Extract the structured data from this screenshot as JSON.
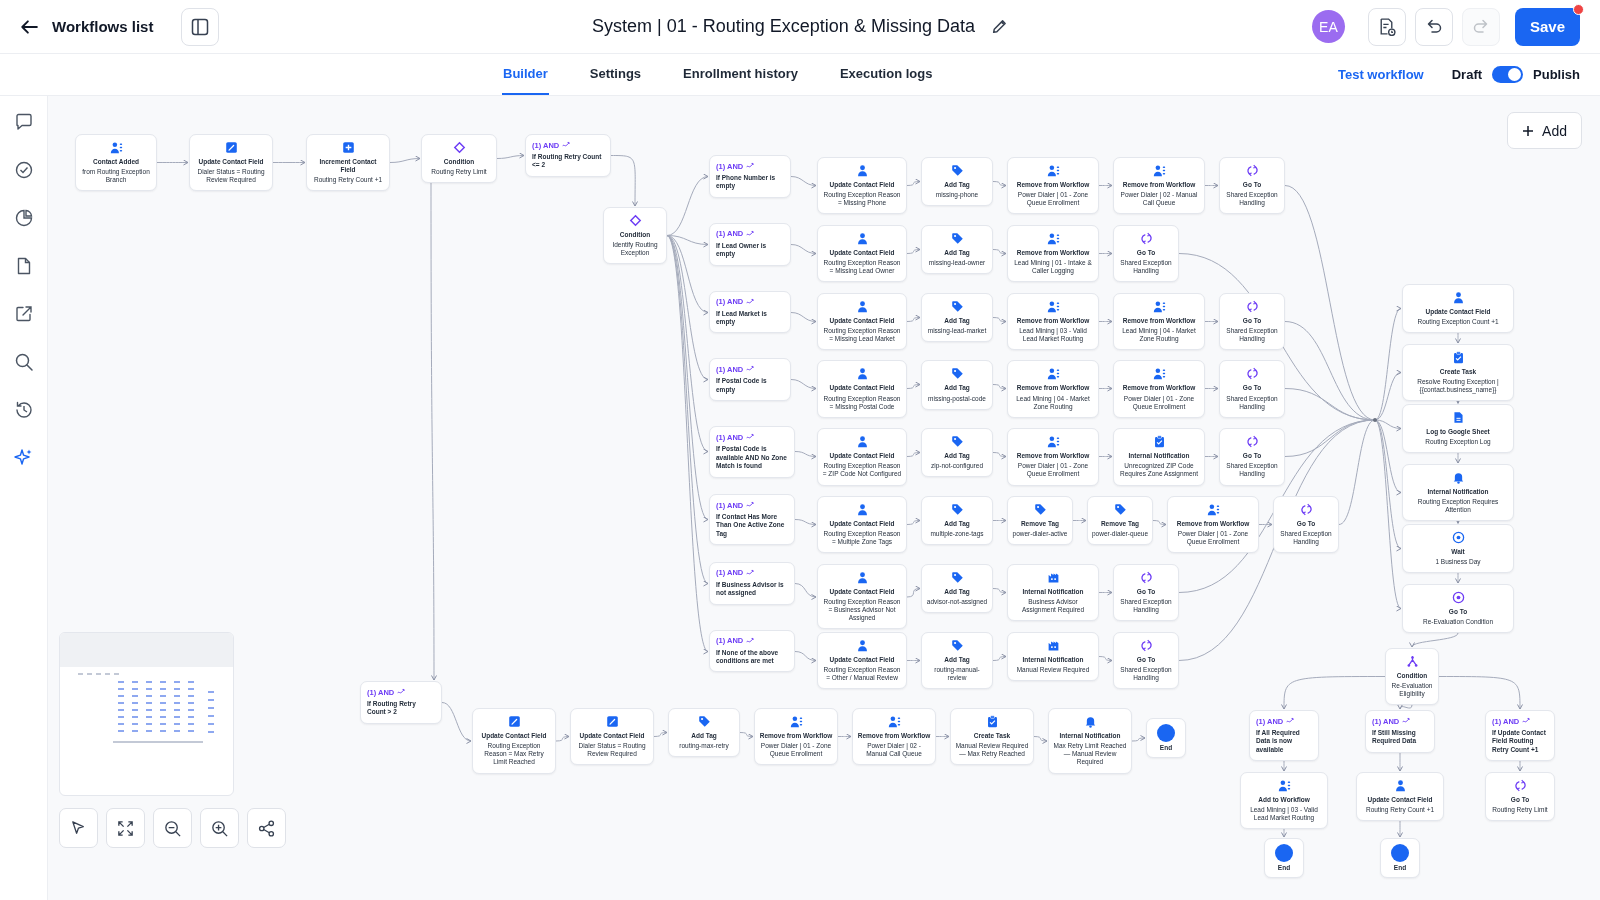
{
  "header": {
    "back_link": "Workflows list",
    "title": "System | 01 - Routing Exception & Missing Data",
    "avatar": "EA",
    "history": [
      {
        "kind": "undo",
        "disabled": false
      },
      {
        "kind": "redo",
        "disabled": true
      }
    ],
    "save": "Save",
    "unsaved": true
  },
  "tabs": [
    {
      "label": "Builder",
      "selected": true
    },
    {
      "label": "Settings",
      "selected": false
    },
    {
      "label": "Enrollment history",
      "selected": false
    },
    {
      "label": "Execution logs",
      "selected": false
    }
  ],
  "test_workflow": "Test workflow",
  "draft_label": "Draft",
  "publish_toggle": {
    "on": true
  },
  "publish_label": "Publish",
  "canvas": {
    "add_button": "Add",
    "start_chain": [
      {
        "kind": "trigger",
        "title": "Contact Added",
        "detail": "from Routing Exception Branch"
      },
      {
        "kind": "field_edit",
        "title": "Update Contact Field",
        "detail": "Dialer Status = Routing Review Required"
      },
      {
        "kind": "increment",
        "title": "Increment Contact Field",
        "detail": "Routing Retry Count +1"
      },
      {
        "kind": "condition",
        "title": "Condition",
        "detail": "Routing Retry Limit"
      }
    ],
    "retry_ok_branch": {
      "badge": "(1) AND",
      "label": "If Routing Retry Count <= 2",
      "condition": {
        "kind": "condition",
        "title": "Condition",
        "detail": "Identify Routing Exception"
      }
    },
    "exception_branches": [
      {
        "badge": "(1) AND",
        "label": "If Phone Number is empty",
        "steps": [
          {
            "kind": "update",
            "title": "Update Contact Field",
            "detail": "Routing Exception Reason = Missing Phone"
          },
          {
            "kind": "tag",
            "title": "Add Tag",
            "detail": "missing-phone"
          },
          {
            "kind": "remove",
            "title": "Remove from Workflow",
            "detail": "Power Dialer | 01 - Zone Queue Enrollment"
          },
          {
            "kind": "remove",
            "title": "Remove from Workflow",
            "detail": "Power Dialer | 02 - Manual Call Queue"
          },
          {
            "kind": "goto",
            "title": "Go To",
            "detail": "Shared Exception Handling"
          }
        ]
      },
      {
        "badge": "(1) AND",
        "label": "If Lead Owner is empty",
        "steps": [
          {
            "kind": "update",
            "title": "Update Contact Field",
            "detail": "Routing Exception Reason = Missing Lead Owner"
          },
          {
            "kind": "tag",
            "title": "Add Tag",
            "detail": "missing-lead-owner"
          },
          {
            "kind": "remove",
            "title": "Remove from Workflow",
            "detail": "Lead Mining | 01 - Intake & Caller Logging"
          },
          {
            "kind": "goto",
            "title": "Go To",
            "detail": "Shared Exception Handling"
          }
        ]
      },
      {
        "badge": "(1) AND",
        "label": "If Lead Market is empty",
        "steps": [
          {
            "kind": "update",
            "title": "Update Contact Field",
            "detail": "Routing Exception Reason = Missing Lead Market"
          },
          {
            "kind": "tag",
            "title": "Add Tag",
            "detail": "missing-lead-market"
          },
          {
            "kind": "remove",
            "title": "Remove from Workflow",
            "detail": "Lead Mining | 03 - Valid Lead Market Routing"
          },
          {
            "kind": "remove",
            "title": "Remove from Workflow",
            "detail": "Lead Mining | 04 - Market Zone Routing"
          },
          {
            "kind": "goto",
            "title": "Go To",
            "detail": "Shared Exception Handling"
          }
        ]
      },
      {
        "badge": "(1) AND",
        "label": "If Postal Code is empty",
        "steps": [
          {
            "kind": "update",
            "title": "Update Contact Field",
            "detail": "Routing Exception Reason = Missing Postal Code"
          },
          {
            "kind": "tag",
            "title": "Add Tag",
            "detail": "missing-postal-code"
          },
          {
            "kind": "remove",
            "title": "Remove from Workflow",
            "detail": "Lead Mining | 04 - Market Zone Routing"
          },
          {
            "kind": "remove",
            "title": "Remove from Workflow",
            "detail": "Power Dialer | 01 - Zone Queue Enrollment"
          },
          {
            "kind": "goto",
            "title": "Go To",
            "detail": "Shared Exception Handling"
          }
        ]
      },
      {
        "badge": "(1) AND",
        "label": "If Postal Code is available AND No Zone Match is found",
        "steps": [
          {
            "kind": "update",
            "title": "Update Contact Field",
            "detail": "Routing Exception Reason = ZIP Code Not Configured"
          },
          {
            "kind": "tag",
            "title": "Add Tag",
            "detail": "zip-not-configured"
          },
          {
            "kind": "remove",
            "title": "Remove from Workflow",
            "detail": "Power Dialer | 01 - Zone Queue Enrollment"
          },
          {
            "kind": "task_notify",
            "title": "Internal Notification",
            "detail": "Unrecognized ZIP Code Requires Zone Assignment"
          },
          {
            "kind": "goto",
            "title": "Go To",
            "detail": "Shared Exception Handling"
          }
        ]
      },
      {
        "badge": "(1) AND",
        "label": "If Contact Has More Than One Active Zone Tag",
        "steps": [
          {
            "kind": "update",
            "title": "Update Contact Field",
            "detail": "Routing Exception Reason = Multiple Zone Tags"
          },
          {
            "kind": "tag",
            "title": "Add Tag",
            "detail": "multiple-zone-tags"
          },
          {
            "kind": "remove_tag",
            "title": "Remove Tag",
            "detail": "power-dialer-active"
          },
          {
            "kind": "remove_tag",
            "title": "Remove Tag",
            "detail": "power-dialer-queue"
          },
          {
            "kind": "remove",
            "title": "Remove from Workflow",
            "detail": "Power Dialer | 01 - Zone Queue Enrollment"
          },
          {
            "kind": "goto",
            "title": "Go To",
            "detail": "Shared Exception Handling"
          }
        ]
      },
      {
        "badge": "(1) AND",
        "label": "If Business Advisor is not assigned",
        "steps": [
          {
            "kind": "update",
            "title": "Update Contact Field",
            "detail": "Routing Exception Reason = Business Advisor Not Assigned"
          },
          {
            "kind": "tag",
            "title": "Add Tag",
            "detail": "advisor-not-assigned"
          },
          {
            "kind": "notify",
            "title": "Internal Notification",
            "detail": "Business Advisor Assignment Required"
          },
          {
            "kind": "goto",
            "title": "Go To",
            "detail": "Shared Exception Handling"
          }
        ]
      },
      {
        "badge": "(1) AND",
        "label": "If None of the above conditions are met",
        "steps": [
          {
            "kind": "update",
            "title": "Update Contact Field",
            "detail": "Routing Exception Reason = Other / Manual Review"
          },
          {
            "kind": "tag",
            "title": "Add Tag",
            "detail": "routing-manual-review"
          },
          {
            "kind": "notify",
            "title": "Internal Notification",
            "detail": "Manual Review Required"
          },
          {
            "kind": "goto",
            "title": "Go To",
            "detail": "Shared Exception Handling"
          }
        ]
      }
    ],
    "retry_exceeded_branch": {
      "badge": "(1) AND",
      "label": "If Routing Retry Count > 2",
      "steps": [
        {
          "kind": "field_edit",
          "title": "Update Contact Field",
          "detail": "Routing Exception Reason = Max Retry Limit Reached"
        },
        {
          "kind": "field_edit",
          "title": "Update Contact Field",
          "detail": "Dialer Status = Routing Review Required"
        },
        {
          "kind": "tag",
          "title": "Add Tag",
          "detail": "routing-max-retry"
        },
        {
          "kind": "remove",
          "title": "Remove from Workflow",
          "detail": "Power Dialer | 01 - Zone Queue Enrollment"
        },
        {
          "kind": "remove",
          "title": "Remove from Workflow",
          "detail": "Power Dialer | 02 - Manual Call Queue"
        },
        {
          "kind": "task",
          "title": "Create Task",
          "detail": "Manual Review Required — Max Retry Reached"
        },
        {
          "kind": "bell",
          "title": "Internal Notification",
          "detail": "Max Retry Limit Reached — Manual Review Required"
        },
        {
          "kind": "end",
          "title": "End"
        }
      ]
    },
    "shared_handling": [
      {
        "kind": "update",
        "title": "Update Contact Field",
        "detail": "Routing Exception Count +1"
      },
      {
        "kind": "task",
        "title": "Create Task",
        "detail": "Resolve Routing Exception | {{contact.business_name}}"
      },
      {
        "kind": "sheet",
        "title": "Log to Google Sheet",
        "detail": "Routing Exception Log"
      },
      {
        "kind": "bell",
        "title": "Internal Notification",
        "detail": "Routing Exception Requires Attention"
      },
      {
        "kind": "wait",
        "title": "Wait",
        "detail": "1 Business Day"
      },
      {
        "kind": "goto_target",
        "title": "Go To",
        "detail": "Re-Evaluation Condition"
      }
    ],
    "reevaluation_condition": {
      "kind": "split",
      "title": "Condition",
      "detail": "Re-Evaluation Eligibility"
    },
    "reevaluation_branches": [
      {
        "badge": "(1) AND",
        "label": "If All Required Data is now available",
        "steps": [
          {
            "kind": "add_workflow",
            "title": "Add to Workflow",
            "detail": "Lead Mining | 03 - Valid Lead Market Routing"
          },
          {
            "kind": "end",
            "title": "End"
          }
        ]
      },
      {
        "badge": "(1) AND",
        "label": "If Still Missing Required Data",
        "steps": [
          {
            "kind": "update",
            "title": "Update Contact Field",
            "detail": "Routing Retry Count +1"
          },
          {
            "kind": "end",
            "title": "End"
          }
        ]
      },
      {
        "badge": "(1) AND",
        "label": "If Update Contact Field Routing Retry Count +1",
        "steps": [
          {
            "kind": "goto",
            "title": "Go To",
            "detail": "Routing Retry Limit"
          }
        ]
      }
    ]
  }
}
